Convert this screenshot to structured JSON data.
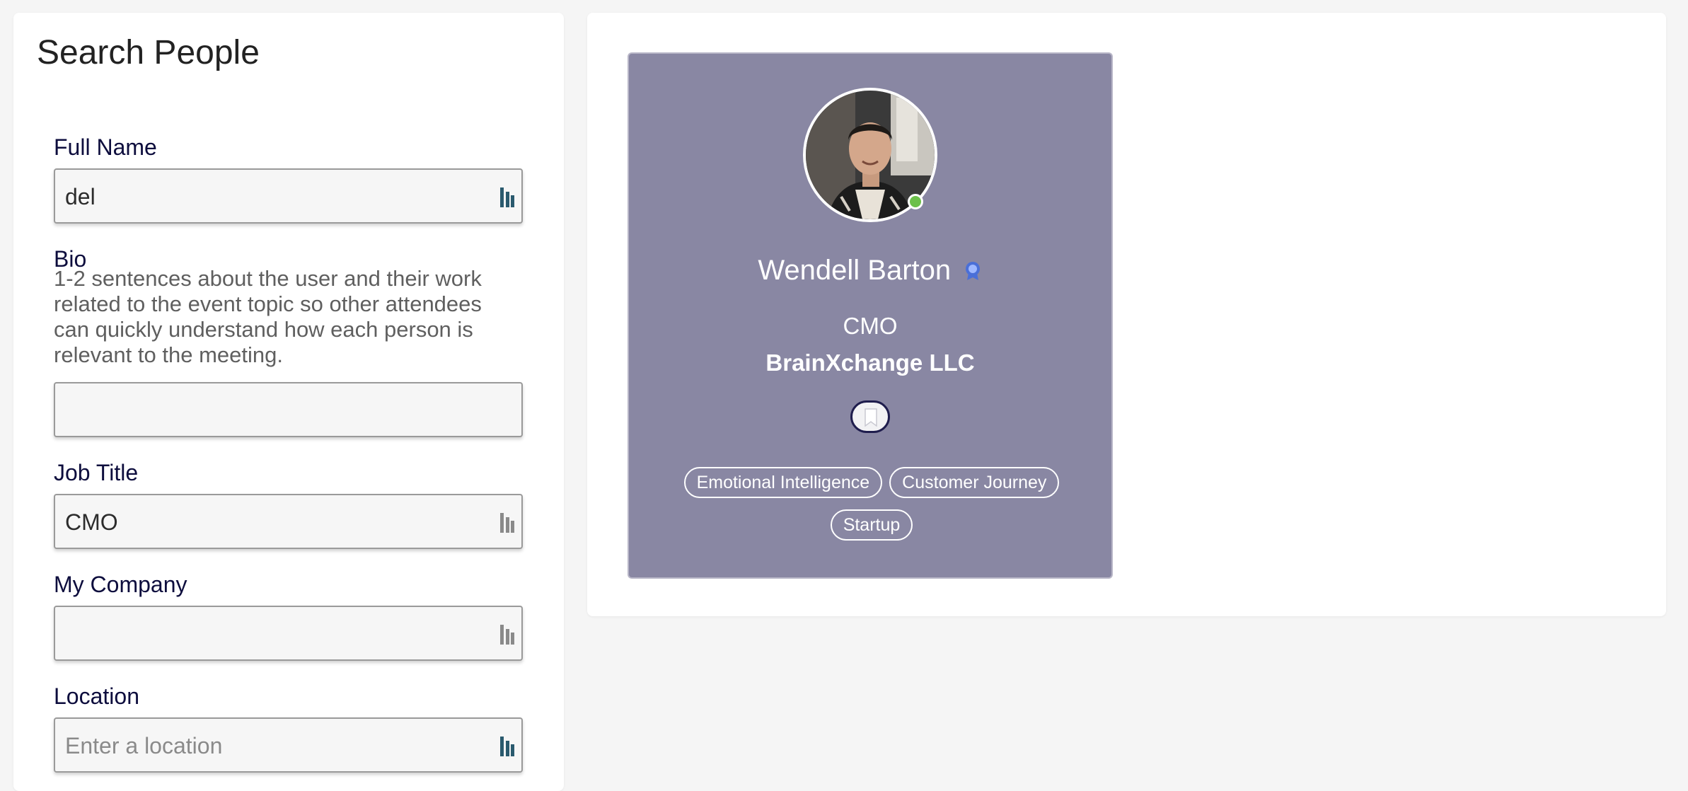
{
  "search": {
    "title": "Search People",
    "fields": {
      "full_name": {
        "label": "Full Name",
        "value": "del"
      },
      "bio": {
        "label": "Bio",
        "help": "1-2 sentences about the user and their work related to the event topic so other attendees can quickly understand how each person is relevant to the meeting.",
        "value": ""
      },
      "job_title": {
        "label": "Job Title",
        "value": "CMO"
      },
      "company": {
        "label": "My Company",
        "value": ""
      },
      "location": {
        "label": "Location",
        "value": "",
        "placeholder": "Enter a location"
      }
    }
  },
  "results": {
    "cards": [
      {
        "name": "Wendell Barton",
        "title": "CMO",
        "company": "BrainXchange LLC",
        "online": true,
        "verified_icon": "verified-badge-icon",
        "tags": [
          "Emotional Intelligence",
          "Customer Journey",
          "Startup"
        ]
      }
    ]
  },
  "colors": {
    "card_background": "#8987a3",
    "label_text": "#0d0d3d",
    "online_dot": "#6cc04a",
    "field_icon_active": "#2a5a6e",
    "field_icon_inactive": "#8a8a8a"
  },
  "icons": {
    "field_autofill": "password-manager-icon",
    "bookmark": "bookmark-icon",
    "verified": "verified-badge-icon"
  }
}
